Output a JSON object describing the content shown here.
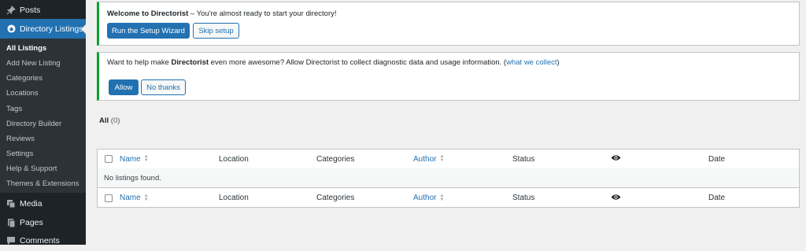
{
  "sidebar": {
    "posts": {
      "label": "Posts",
      "icon": "pushpin-icon"
    },
    "directory": {
      "label": "Directory Listings",
      "icon": "directory-icon"
    },
    "submenu": [
      "All Listings",
      "Add New Listing",
      "Categories",
      "Locations",
      "Tags",
      "Directory Builder",
      "Reviews",
      "Settings",
      "Help & Support",
      "Themes & Extensions"
    ],
    "current_submenu": "All Listings",
    "media": {
      "label": "Media",
      "icon": "media-icon"
    },
    "pages": {
      "label": "Pages",
      "icon": "pages-icon"
    },
    "comments": {
      "label": "Comments",
      "icon": "comments-icon"
    }
  },
  "notices": {
    "welcome": {
      "title": "Welcome to Directorist",
      "text": " – You're almost ready to start your directory!",
      "primary_button": "Run the Setup Wizard",
      "secondary_button": "Skip setup"
    },
    "collect": {
      "text_before": "Want to help make ",
      "brand": "Directorist",
      "text_after": " even more awesome? Allow Directorist to collect diagnostic data and usage information. (",
      "link": "what we collect",
      "text_end": ")",
      "allow_button": "Allow",
      "deny_button": "No thanks"
    }
  },
  "views": {
    "all_label": "All",
    "all_count": "(0)"
  },
  "table": {
    "columns": {
      "name": "Name",
      "location": "Location",
      "categories": "Categories",
      "author": "Author",
      "status": "Status",
      "views_icon": "eye-icon",
      "date": "Date"
    },
    "empty_message": "No listings found."
  },
  "colors": {
    "accent": "#2271b1",
    "notice_success": "#00a32a",
    "sidebar_bg": "#1d2327",
    "submenu_bg": "#2c3338"
  }
}
